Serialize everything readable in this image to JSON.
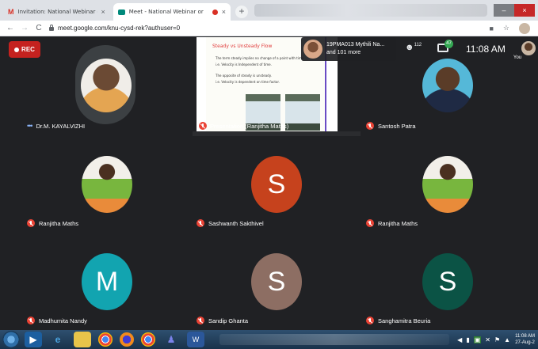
{
  "browser": {
    "tabs": [
      {
        "label": "Invitation: National Webinar on",
        "favicon": "gmail-icon",
        "active": false
      },
      {
        "label": "Meet - National Webinar or",
        "favicon": "meet-icon",
        "active": true,
        "recording": true
      }
    ],
    "url": "meet.google.com/knu-cysd-rek?authuser=0",
    "window_controls": {
      "minimize": "–",
      "close": "×"
    }
  },
  "meeting": {
    "rec_label": "REC",
    "pinned": {
      "name": "19PMA013 Mythili Na...",
      "more": "and 101 more"
    },
    "people_count": "112",
    "chat_badge": "47",
    "time": "11:08 AM",
    "you_label": "You",
    "presenter_name": "Presentation (Ranjitha Maths)",
    "slide": {
      "title": "Steady vs Unsteady Flow",
      "lines": [
        "The term steady implies no change of a point with time.",
        "i.e. Velocity is Independent of time.",
        "The opposite of steady is unsteady.",
        "i.e. Velocity is dependent on time factor."
      ]
    },
    "participants": [
      {
        "name": "Dr.M. KAYALVIZHI",
        "type": "photo",
        "style": "woman",
        "muted": false
      },
      {
        "name": "Santosh Patra",
        "type": "photo",
        "style": "man",
        "muted": true
      },
      {
        "name": "Ranjitha Maths",
        "type": "photo",
        "style": "saree",
        "muted": true
      },
      {
        "name": "Sashwanth Sakthivel",
        "type": "letter",
        "letter": "S",
        "color": "#c6421d",
        "muted": true
      },
      {
        "name": "Ranjitha Maths",
        "type": "photo",
        "style": "saree",
        "muted": true
      },
      {
        "name": "Madhumita Nandy",
        "type": "letter",
        "letter": "M",
        "color": "#12a4b0",
        "muted": true
      },
      {
        "name": "Sandip Ghanta",
        "type": "letter",
        "letter": "S",
        "color": "#8d6e63",
        "muted": true
      },
      {
        "name": "Sanghamitra Beuria",
        "type": "letter",
        "letter": "S",
        "color": "#0b5345",
        "muted": true
      }
    ]
  },
  "taskbar": {
    "clock_time": "11:08 AM",
    "clock_date": "27-Aug-2"
  }
}
